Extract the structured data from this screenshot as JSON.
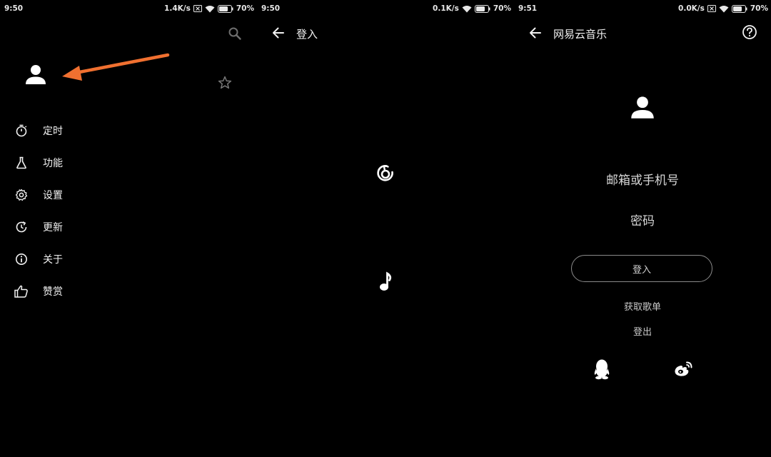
{
  "panels": [
    {
      "status": {
        "time": "9:50",
        "speed": "1.4K/s",
        "battery": "70%"
      },
      "menu": [
        {
          "label": "定时",
          "icon": "timer-icon"
        },
        {
          "label": "功能",
          "icon": "flask-icon"
        },
        {
          "label": "设置",
          "icon": "gear-icon"
        },
        {
          "label": "更新",
          "icon": "update-icon"
        },
        {
          "label": "关于",
          "icon": "info-icon"
        },
        {
          "label": "赞赏",
          "icon": "thumbs-up-icon"
        }
      ]
    },
    {
      "status": {
        "time": "9:50",
        "speed": "0.1K/s",
        "battery": "70%"
      },
      "title": "登入"
    },
    {
      "status": {
        "time": "9:51",
        "speed": "0.0K/s",
        "battery": "70%"
      },
      "title": "网易云音乐",
      "email_label": "邮箱或手机号",
      "password_label": "密码",
      "login_button": "登入",
      "get_playlist": "获取歌单",
      "logout": "登出"
    }
  ],
  "colors": {
    "background": "#000000",
    "text": "#f2f2f2",
    "annotation_arrow": "#f07030",
    "dim_icon": "#7a7a7a"
  }
}
